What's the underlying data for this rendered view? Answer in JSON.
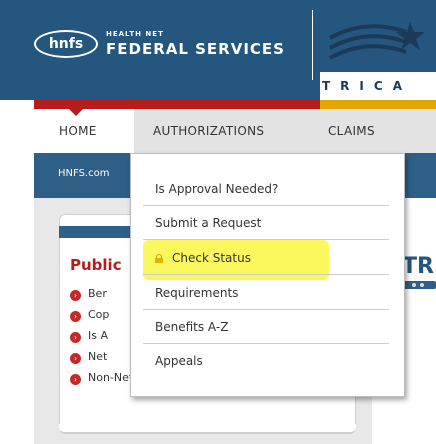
{
  "header": {
    "logo_text": "hnfs",
    "brand_small": "HEALTH NET",
    "brand_big": "FEDERAL SERVICES",
    "partner_text": "TRICA"
  },
  "nav": {
    "items": [
      {
        "label": "HOME"
      },
      {
        "label": "AUTHORIZATIONS"
      },
      {
        "label": "CLAIMS"
      }
    ]
  },
  "breadcrumb": "HNFS.com",
  "dropdown": {
    "items": [
      {
        "label": "Is Approval Needed?"
      },
      {
        "label": "Submit a Request"
      },
      {
        "label": "Check Status",
        "icon": "lock-icon",
        "highlighted": true
      },
      {
        "label": "Requirements"
      },
      {
        "label": "Benefits A-Z"
      },
      {
        "label": "Appeals"
      }
    ]
  },
  "sidebar": {
    "heading": "Public",
    "links": [
      {
        "label": "Ber"
      },
      {
        "label": "Cop"
      },
      {
        "label": "Is A"
      },
      {
        "label": "Net"
      },
      {
        "label": "Non-Network Provider Directory"
      }
    ]
  },
  "main": {
    "title": "TR"
  },
  "colors": {
    "header_blue": "#25567e",
    "band_blue": "#2e5f86",
    "accent_red": "#b71c1c",
    "accent_gold": "#e0a800",
    "highlight_yellow": "#faf85c"
  }
}
